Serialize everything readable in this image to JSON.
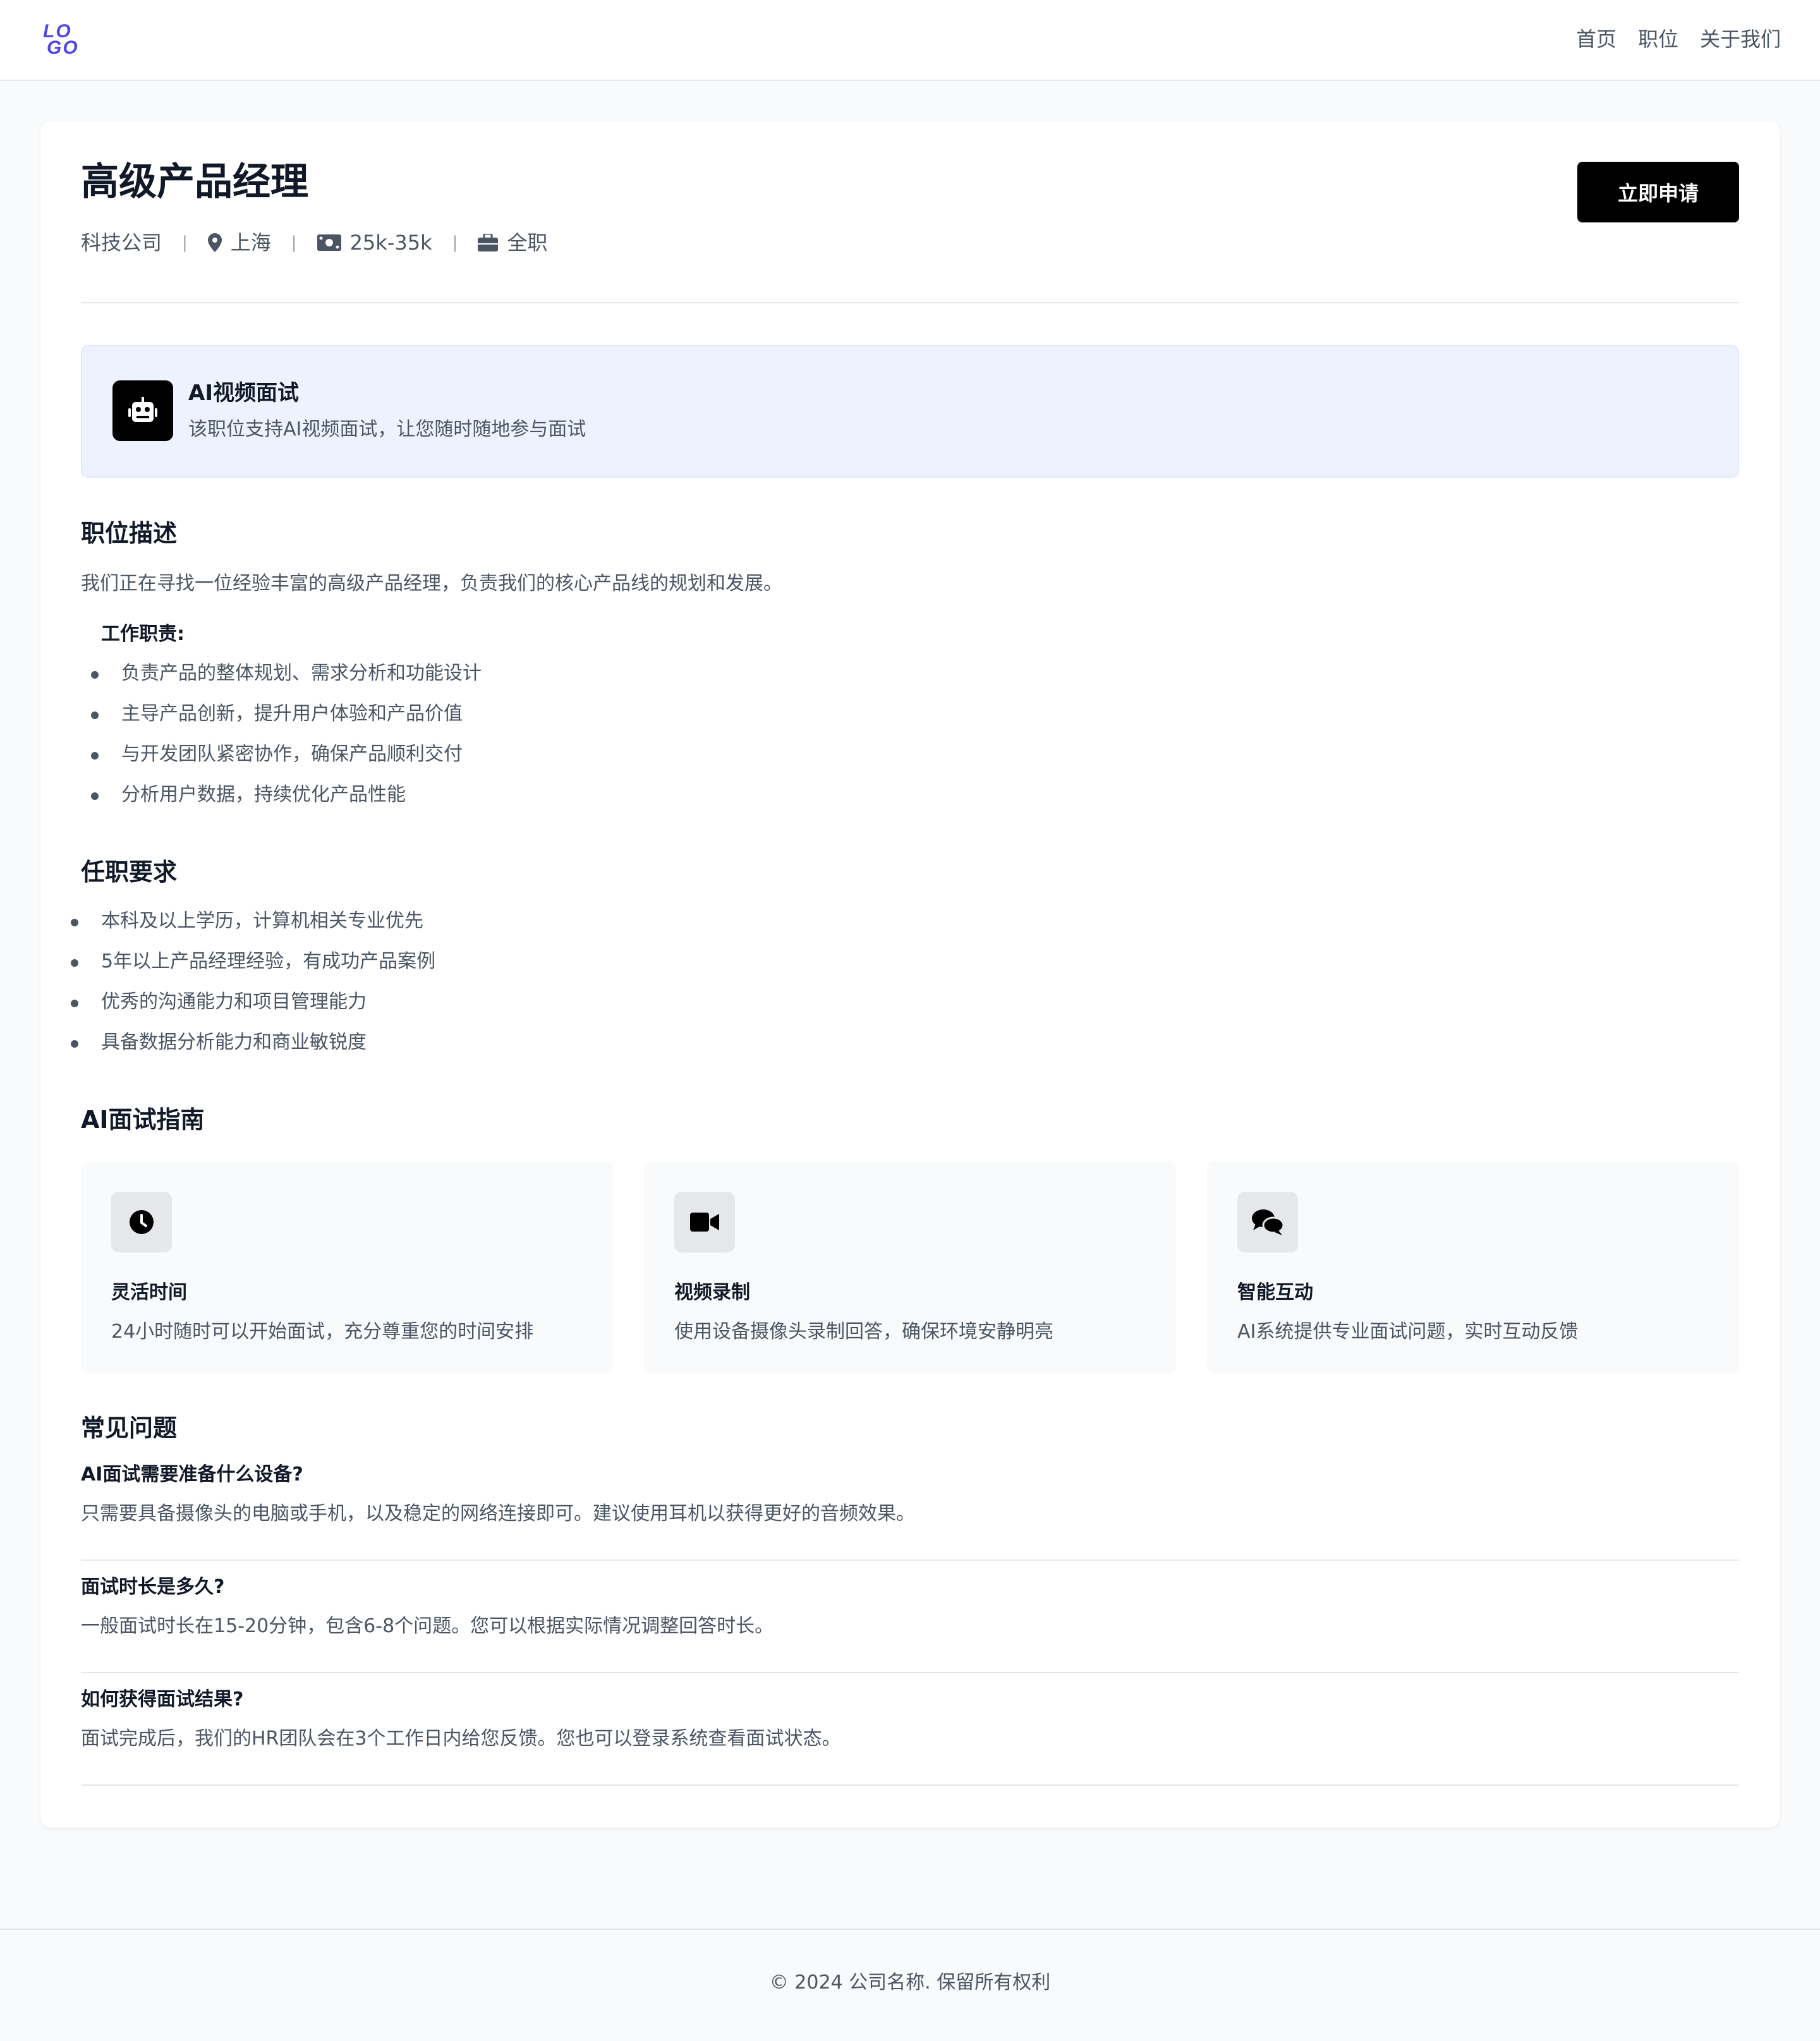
{
  "brand": {
    "logo_top": "LO",
    "logo_bottom": "GO"
  },
  "nav": {
    "items": [
      "首页",
      "职位",
      "关于我们"
    ]
  },
  "job": {
    "title": "高级产品经理",
    "company": "科技公司",
    "location": "上海",
    "salary": "25k-35k",
    "type": "全职",
    "apply_label": "立即申请"
  },
  "ai_banner": {
    "title": "AI视频面试",
    "desc": "该职位支持AI视频面试，让您随时随地参与面试"
  },
  "description": {
    "heading": "职位描述",
    "intro": "我们正在寻找一位经验丰富的高级产品经理，负责我们的核心产品线的规划和发展。",
    "duties_label": "工作职责:",
    "duties": [
      "负责产品的整体规划、需求分析和功能设计",
      "主导产品创新，提升用户体验和产品价值",
      "与开发团队紧密协作，确保产品顺利交付",
      "分析用户数据，持续优化产品性能"
    ]
  },
  "requirements": {
    "heading": "任职要求",
    "items": [
      "本科及以上学历，计算机相关专业优先",
      "5年以上产品经理经验，有成功产品案例",
      "优秀的沟通能力和项目管理能力",
      "具备数据分析能力和商业敏锐度"
    ]
  },
  "guide": {
    "heading": "AI面试指南",
    "cards": [
      {
        "icon": "clock-icon",
        "title": "灵活时间",
        "desc": "24小时随时可以开始面试，充分尊重您的时间安排"
      },
      {
        "icon": "video-camera-icon",
        "title": "视频录制",
        "desc": "使用设备摄像头录制回答，确保环境安静明亮"
      },
      {
        "icon": "chat-bubbles-icon",
        "title": "智能互动",
        "desc": "AI系统提供专业面试问题，实时互动反馈"
      }
    ]
  },
  "faq": {
    "heading": "常见问题",
    "items": [
      {
        "q": "AI面试需要准备什么设备?",
        "a": "只需要具备摄像头的电脑或手机，以及稳定的网络连接即可。建议使用耳机以获得更好的音频效果。"
      },
      {
        "q": "面试时长是多久?",
        "a": "一般面试时长在15-20分钟，包含6-8个问题。您可以根据实际情况调整回答时长。"
      },
      {
        "q": "如何获得面试结果?",
        "a": "面试完成后，我们的HR团队会在3个工作日内给您反馈。您也可以登录系统查看面试状态。"
      }
    ]
  },
  "footer": {
    "copyright": "© 2024 公司名称. 保留所有权利"
  },
  "colors": {
    "accent": "#4f46e5",
    "banner_bg": "#eef2ff",
    "button_bg": "#000000"
  }
}
